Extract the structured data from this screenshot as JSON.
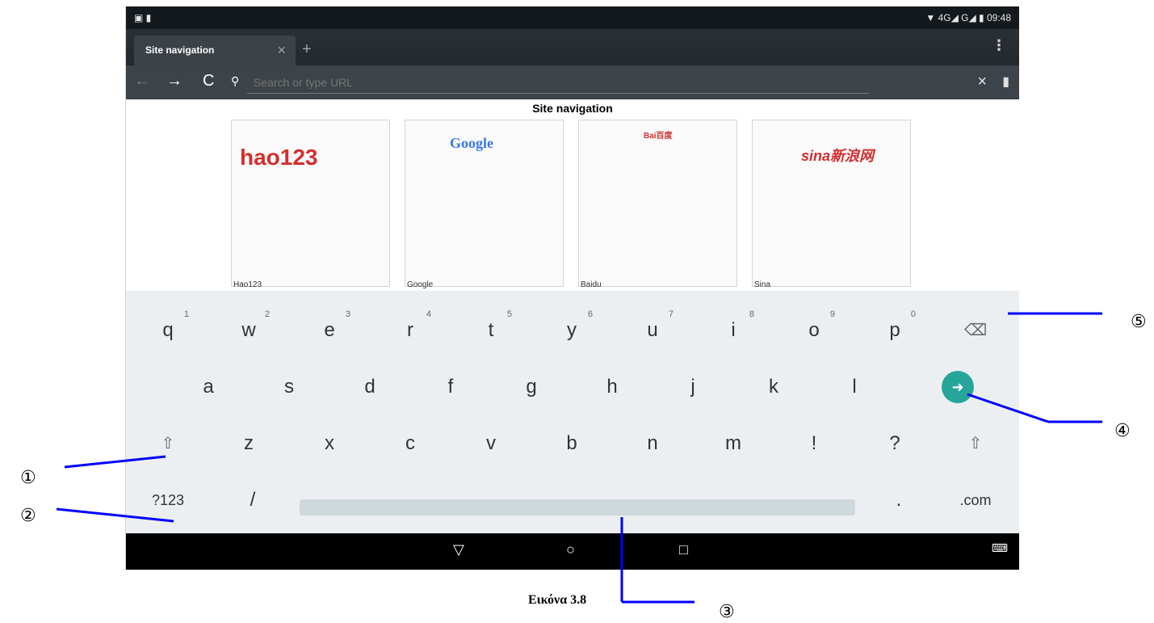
{
  "statusbar": {
    "time": "09:48",
    "signal": "▼ 4G◢ G◢ ▮"
  },
  "browser": {
    "tab_title": "Site navigation",
    "new_tab_label": "+",
    "close_tab": "×",
    "url_placeholder": "Search or type URL",
    "clear_icon": "×",
    "bookmark_icon": "bookmark-icon",
    "menu_icon": "⋮"
  },
  "page": {
    "title": "Site navigation"
  },
  "thumbnails": [
    {
      "label": "Hao123",
      "brand": "hao123"
    },
    {
      "label": "Google",
      "brand": "Google"
    },
    {
      "label": "Baidu",
      "brand": "Bai百度"
    },
    {
      "label": "Sina",
      "brand": "sina新浪网"
    }
  ],
  "keyboard": {
    "row1": [
      "q",
      "w",
      "e",
      "r",
      "t",
      "y",
      "u",
      "i",
      "o",
      "p"
    ],
    "row1_nums": [
      "1",
      "2",
      "3",
      "4",
      "5",
      "6",
      "7",
      "8",
      "9",
      "0"
    ],
    "row2": [
      "a",
      "s",
      "d",
      "f",
      "g",
      "h",
      "j",
      "k",
      "l"
    ],
    "row3": [
      "z",
      "x",
      "c",
      "v",
      "b",
      "n",
      "m",
      "!",
      "?"
    ],
    "mode_key": "?123",
    "slash_key": "/",
    "period_key": ".",
    "com_key": ".com",
    "backspace_icon": "⌫",
    "go_icon": "➜",
    "shift_icon": "⇧"
  },
  "navbar": {
    "back": "▽",
    "home": "○",
    "recent": "□",
    "keyboard": "⌨"
  },
  "caption": "Εικόνα 3.8",
  "markers": [
    "①",
    "②",
    "③",
    "④",
    "⑤"
  ]
}
